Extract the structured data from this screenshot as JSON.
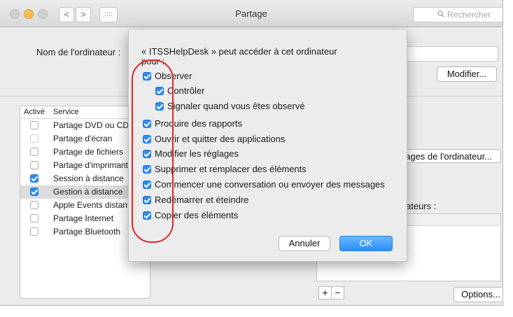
{
  "window": {
    "title": "Partage"
  },
  "toolbar": {
    "back": "<",
    "forward": ">",
    "grid": "::::",
    "search_placeholder": "Rechercher"
  },
  "computer": {
    "label": "Nom de l'ordinateur :",
    "edit_button": "Modifier..."
  },
  "services": {
    "header_enabled": "Activé",
    "header_service": "Service",
    "rows": [
      {
        "name": "Partage DVD ou CD",
        "checked": false,
        "disabled": false
      },
      {
        "name": "Partage d'écran",
        "checked": false,
        "disabled": true
      },
      {
        "name": "Partage de fichiers",
        "checked": false,
        "disabled": false
      },
      {
        "name": "Partage d'imprimantes",
        "checked": false,
        "disabled": false
      },
      {
        "name": "Session à distance",
        "checked": true,
        "disabled": false
      },
      {
        "name": "Gestion à distance",
        "checked": true,
        "disabled": false,
        "selected": true
      },
      {
        "name": "Apple Events distants",
        "checked": false,
        "disabled": false
      },
      {
        "name": "Partage Internet",
        "checked": false,
        "disabled": false
      },
      {
        "name": "Partage Bluetooth",
        "checked": false,
        "disabled": false
      }
    ]
  },
  "right": {
    "settings_popup": "glages de l'ordinateur...",
    "users_label": "ateurs :",
    "options_button": "Options...",
    "add": "+",
    "remove": "−"
  },
  "sheet": {
    "intro_line1": "« ITSSHelpDesk » peut accéder à cet ordinateur",
    "intro_line2": "pour :",
    "options": [
      {
        "label": "Observer",
        "checked": true
      },
      {
        "label": "Contrôler",
        "checked": true
      },
      {
        "label": "Signaler quand vous êtes observé",
        "checked": true
      },
      {
        "label": "Produire des rapports",
        "checked": true
      },
      {
        "label": "Ouvrir et quitter des applications",
        "checked": true
      },
      {
        "label": "Modifier les réglages",
        "checked": true
      },
      {
        "label": "Supprimer et remplacer des éléments",
        "checked": true
      },
      {
        "label": "Commencer une conversation ou envoyer des messages",
        "checked": true
      },
      {
        "label": "Redémarrer et éteindre",
        "checked": true
      },
      {
        "label": "Copier des éléments",
        "checked": true
      }
    ],
    "cancel": "Annuler",
    "ok": "OK"
  },
  "colors": {
    "accent": "#2c8cf4",
    "highlight_loop": "#e0262a"
  }
}
